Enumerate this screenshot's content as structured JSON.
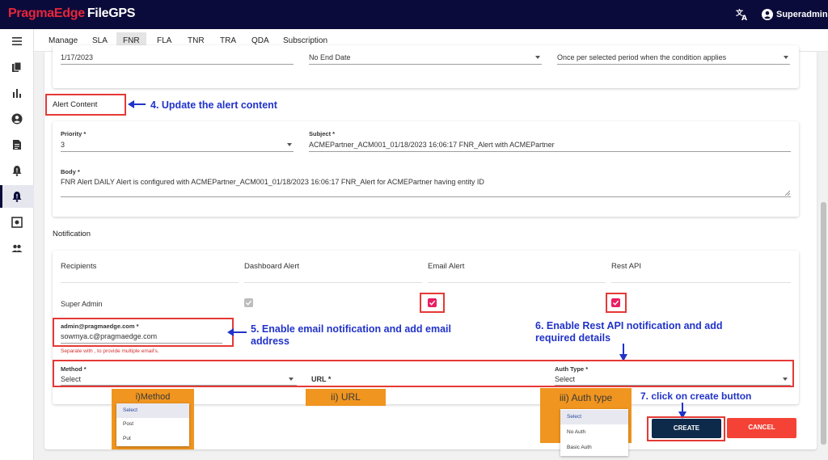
{
  "app": {
    "brand": "PragmaEdge",
    "product": "FileGPS",
    "user": "Superadmin"
  },
  "tabs": [
    {
      "label": "Manage"
    },
    {
      "label": "SLA"
    },
    {
      "label": "FNR",
      "active": true
    },
    {
      "label": "FLA"
    },
    {
      "label": "TNR"
    },
    {
      "label": "TRA"
    },
    {
      "label": "QDA"
    },
    {
      "label": "Subscription"
    }
  ],
  "sidebar": {
    "icons": [
      "menu-icon",
      "files-icon",
      "bar-chart-icon",
      "account-icon",
      "document-icon",
      "alert-bell-icon",
      "alert-config-icon",
      "schedule-icon",
      "users-icon"
    ],
    "active_index": 6
  },
  "schedule": {
    "start_date": "1/17/2023",
    "end_date": "No End Date",
    "frequency": "Once per selected period when the condition applies"
  },
  "alert_content": {
    "title": "Alert Content",
    "priority_label": "Priority *",
    "priority_value": "3",
    "subject_label": "Subject *",
    "subject_value": "ACMEPartner_ACM001_01/18/2023 16:06:17 FNR_Alert with ACMEPartner",
    "body_label": "Body *",
    "body_value": "FNR Alert DAILY Alert is configured with ACMEPartner_ACM001_01/18/2023 16:06:17 FNR_Alert for ACMEPartner having entity ID"
  },
  "notification": {
    "title": "Notification",
    "columns": [
      "Recipients",
      "Dashboard Alert",
      "Email Alert",
      "Rest API"
    ],
    "row_label": "Super Admin",
    "email_label": "admin@pragmaedge.com *",
    "email_value": "sowmya.c@pragmaedge.com",
    "email_hint": "Separate with , to provide multiple email's.",
    "method_label": "Method *",
    "method_value": "Select",
    "url_label": "URL *",
    "auth_label": "Auth Type *",
    "auth_value": "Select"
  },
  "buttons": {
    "create": "CREATE",
    "cancel": "CANCEL"
  },
  "annotations": {
    "step4": "4. Update the alert content",
    "step5_line1": "5. Enable email notification and add email",
    "step5_line2": "address",
    "step6_line1": "6. Enable Rest API notification and add",
    "step6_line2": "required details",
    "step7": "7. click on create button",
    "method_callout": "i)Method",
    "url_callout": "ii) URL",
    "auth_callout": "iii) Auth type"
  },
  "method_options": [
    "Select",
    "Post",
    "Put"
  ],
  "auth_options": [
    "Select",
    "No Auth",
    "Basic Auth"
  ],
  "colors": {
    "navbar": "#0b0b3b",
    "brand_red": "#e8253a",
    "annotation_blue": "#2133c9",
    "callout_orange": "#f0951f",
    "create_btn": "#0d2a4a",
    "cancel_btn": "#f44336",
    "checkbox_pink": "#e91e63"
  }
}
